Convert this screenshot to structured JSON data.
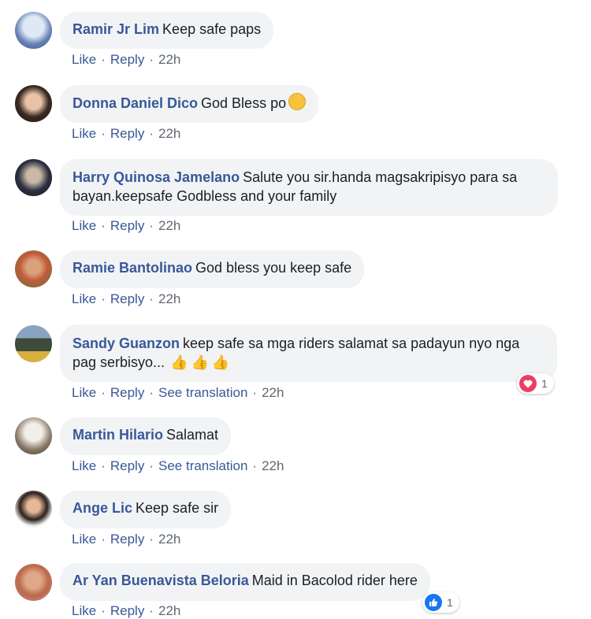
{
  "actions": {
    "like": "Like",
    "reply": "Reply",
    "see_translation": "See translation",
    "separator": "·"
  },
  "colors": {
    "author": "#385898",
    "bubble": "#f2f3f5",
    "love_reaction": "#e9405e",
    "like_reaction": "#1877f2"
  },
  "comments": [
    {
      "author": "Ramir Jr Lim",
      "text": "Keep safe paps",
      "time": "22h"
    },
    {
      "author": "Donna Daniel Dico",
      "text": "God Bless po",
      "emoji": "smiling-face-emoji",
      "time": "22h"
    },
    {
      "author": "Harry Quinosa Jamelano",
      "text": "Salute you sir.handa magsakripisyo para sa bayan.keepsafe Godbless and your family",
      "time": "22h"
    },
    {
      "author": "Ramie Bantolinao",
      "text": "God bless you keep safe",
      "time": "22h"
    },
    {
      "author": "Sandy Guanzon",
      "text": "keep safe sa mga riders salamat sa padayun nyo nga pag serbisyo...",
      "emoji": "thumbs-up-emoji",
      "time": "22h",
      "reaction": {
        "type": "love-icon",
        "count": "1"
      }
    },
    {
      "author": "Martin Hilario",
      "text": "Salamat",
      "time": "22h"
    },
    {
      "author": "Ange Lic",
      "text": "Keep safe sir",
      "time": "22h"
    },
    {
      "author": "Ar Yan Buenavista Beloria",
      "text": "Maid in Bacolod rider here",
      "time": "22h",
      "reaction": {
        "type": "like-icon",
        "count": "1"
      }
    }
  ]
}
